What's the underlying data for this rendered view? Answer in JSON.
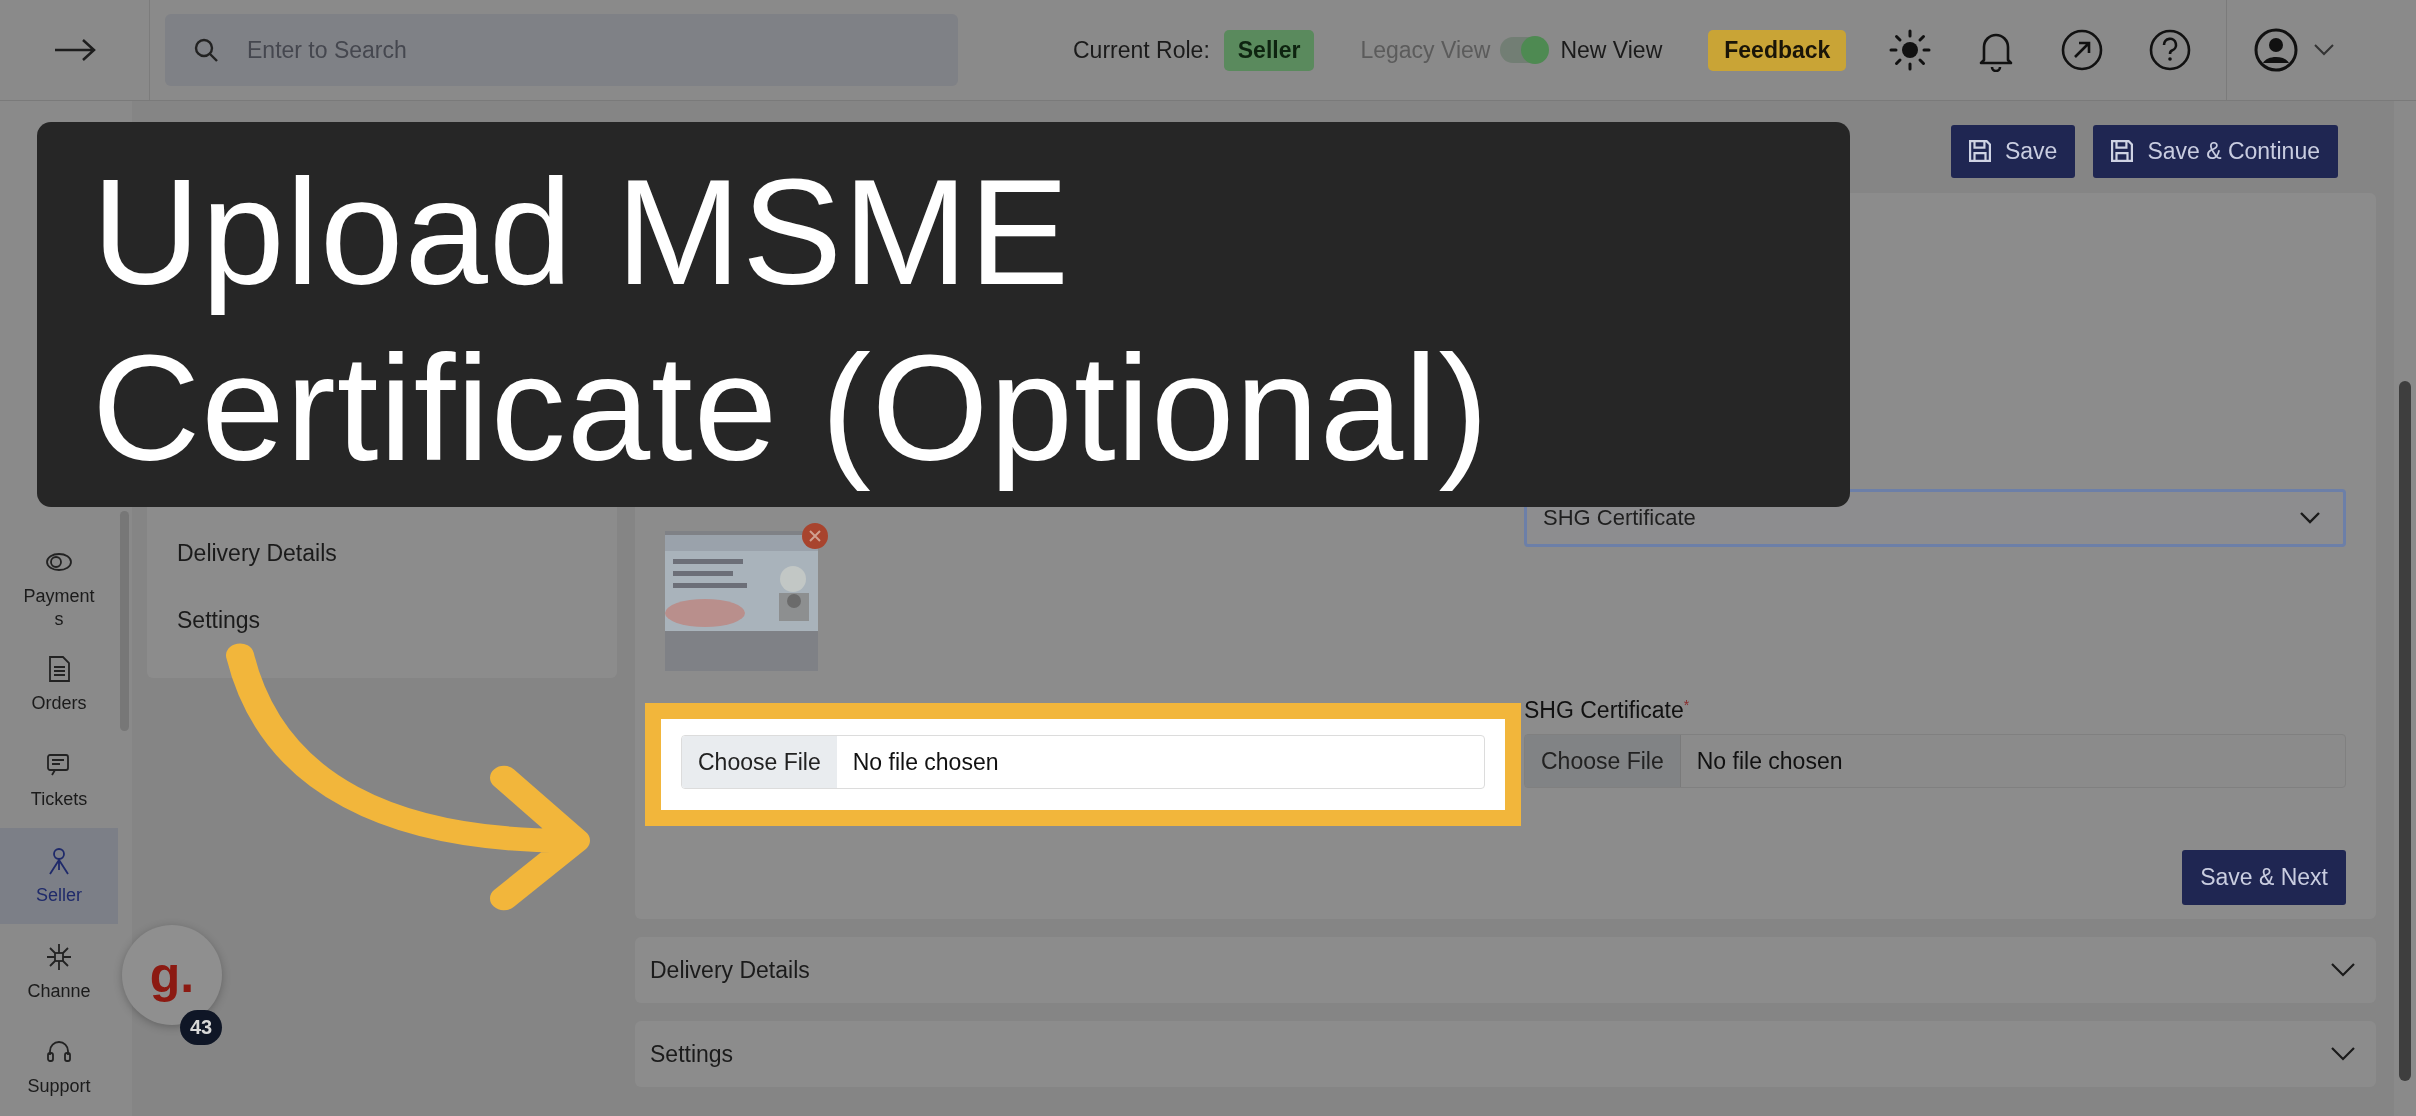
{
  "topbar": {
    "search": {
      "placeholder": "Enter to Search"
    },
    "role_label": "Current Role:",
    "role": "Seller",
    "legacy_view": "Legacy View",
    "new_view": "New View",
    "view_toggle_on": true,
    "feedback": "Feedback"
  },
  "sidebar": {
    "items": [
      {
        "label": "Payments",
        "selected": false
      },
      {
        "label": "Orders",
        "selected": false
      },
      {
        "label": "Tickets",
        "selected": false
      },
      {
        "label": "Seller",
        "selected": true
      },
      {
        "label": "Channe",
        "selected": false
      },
      {
        "label": "Support",
        "selected": false
      }
    ]
  },
  "header": {
    "save": "Save",
    "save_continue": "Save & Continue"
  },
  "quick_nav": {
    "items": [
      "Delivery Details",
      "Settings"
    ]
  },
  "form": {
    "document_select": {
      "value": "SHG Certificate"
    },
    "shg": {
      "label": "SHG Certificate",
      "required_mark": "*",
      "button": "Choose File",
      "status": "No file chosen"
    },
    "save_next": "Save & Next"
  },
  "accordions": [
    {
      "title": "Delivery Details",
      "expanded": false
    },
    {
      "title": "Settings",
      "expanded": false
    }
  ],
  "highlight": {
    "button": "Choose File",
    "status": "No file chosen"
  },
  "banner": {
    "lines": [
      "Upload MSME",
      "Certificate (Optional)"
    ]
  },
  "chat": {
    "logo": "g.",
    "count": "43"
  }
}
